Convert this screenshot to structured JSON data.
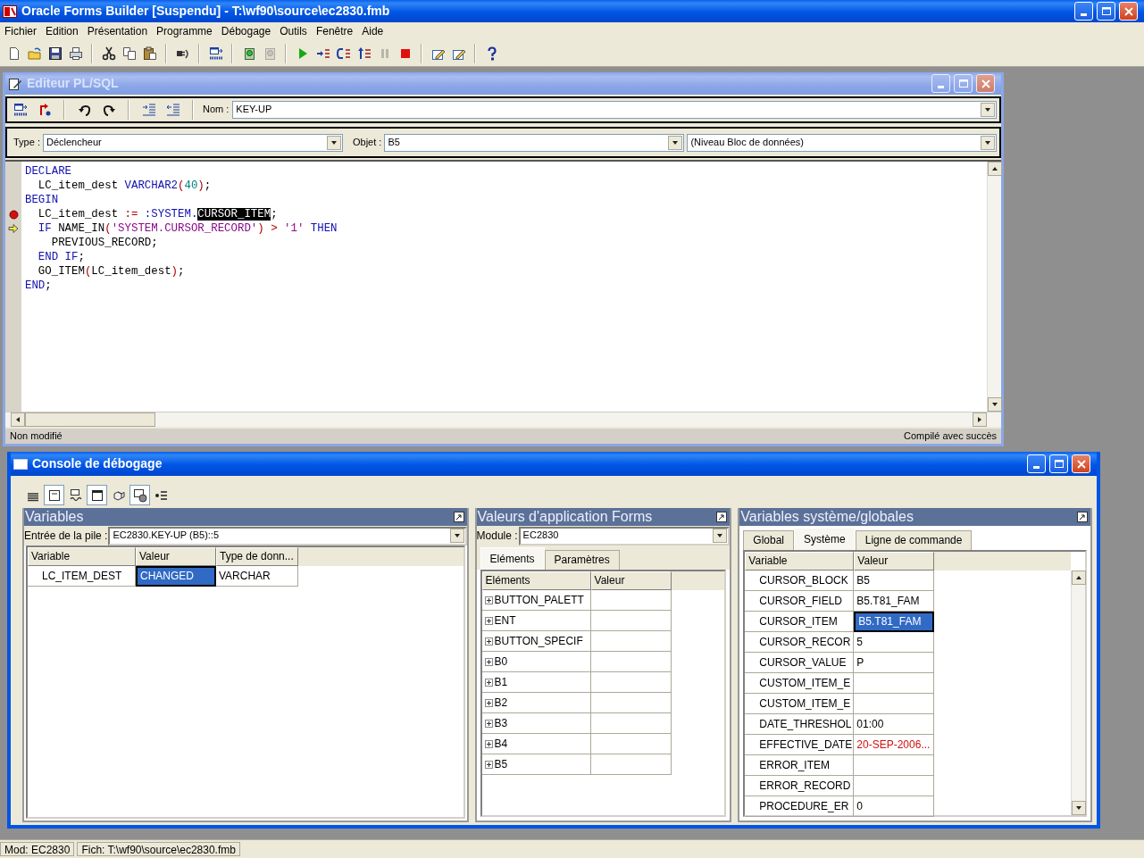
{
  "window": {
    "title": "Oracle Forms Builder [Suspendu] - T:\\wf90\\source\\ec2830.fmb"
  },
  "menu": [
    "Fichier",
    "Edition",
    "Présentation",
    "Programme",
    "Débogage",
    "Outils",
    "Fenêtre",
    "Aide"
  ],
  "toolbar": [
    {
      "kind": "new",
      "disabled": false
    },
    {
      "kind": "open",
      "disabled": false
    },
    {
      "kind": "save",
      "disabled": false
    },
    {
      "kind": "print",
      "disabled": false
    },
    {
      "kind": "sep"
    },
    {
      "kind": "cut",
      "disabled": false
    },
    {
      "kind": "copy",
      "disabled": false
    },
    {
      "kind": "paste",
      "disabled": false
    },
    {
      "kind": "sep"
    },
    {
      "kind": "connect",
      "disabled": false
    },
    {
      "kind": "sep"
    },
    {
      "kind": "compile",
      "disabled": false
    },
    {
      "kind": "sep"
    },
    {
      "kind": "run",
      "disabled": false
    },
    {
      "kind": "run",
      "disabled": true
    },
    {
      "kind": "sep"
    },
    {
      "kind": "go",
      "disabled": false
    },
    {
      "kind": "step_into",
      "disabled": false
    },
    {
      "kind": "step_over",
      "disabled": false
    },
    {
      "kind": "step_out",
      "disabled": false
    },
    {
      "kind": "pause",
      "disabled": true
    },
    {
      "kind": "stop",
      "disabled": false
    },
    {
      "kind": "sep"
    },
    {
      "kind": "edit",
      "disabled": false
    },
    {
      "kind": "edit",
      "disabled": false
    },
    {
      "kind": "sep"
    },
    {
      "kind": "help",
      "disabled": false
    }
  ],
  "editor": {
    "title": "Editeur PL/SQL",
    "name_label": "Nom :",
    "name": "KEY-UP",
    "type_label": "Type :",
    "type": "Déclencheur",
    "object_label": "Objet :",
    "object": "B5",
    "level": "(Niveau Bloc de données)",
    "lines": [
      {
        "breakpoint": false,
        "current": false,
        "tokens": [
          {
            "kind": "keyword",
            "text": "DECLARE"
          }
        ]
      },
      {
        "breakpoint": false,
        "current": false,
        "tokens": [
          {
            "kind": "plain",
            "text": "  LC_item_dest "
          },
          {
            "kind": "keyword",
            "text": "VARCHAR2"
          },
          {
            "kind": "operator",
            "text": "("
          },
          {
            "kind": "number",
            "text": "40"
          },
          {
            "kind": "operator",
            "text": ")"
          },
          {
            "kind": "plain",
            "text": ";"
          }
        ]
      },
      {
        "breakpoint": false,
        "current": false,
        "tokens": [
          {
            "kind": "keyword",
            "text": "BEGIN"
          }
        ]
      },
      {
        "breakpoint": true,
        "current": false,
        "tokens": [
          {
            "kind": "plain",
            "text": "  LC_item_dest "
          },
          {
            "kind": "operator",
            "text": ":="
          },
          {
            "kind": "keyword",
            "text": " :SYSTEM."
          },
          {
            "kind": "selection",
            "text": "CURSOR_ITEM"
          },
          {
            "kind": "plain",
            "text": ";"
          }
        ]
      },
      {
        "breakpoint": false,
        "current": true,
        "tokens": [
          {
            "kind": "keyword",
            "text": "  IF"
          },
          {
            "kind": "plain",
            "text": " NAME_IN"
          },
          {
            "kind": "operator",
            "text": "("
          },
          {
            "kind": "string",
            "text": "'SYSTEM.CURSOR_RECORD'"
          },
          {
            "kind": "operator",
            "text": ") > "
          },
          {
            "kind": "string",
            "text": "'1'"
          },
          {
            "kind": "keyword",
            "text": " THEN"
          }
        ]
      },
      {
        "breakpoint": false,
        "current": false,
        "tokens": [
          {
            "kind": "plain",
            "text": "    PREVIOUS_RECORD;"
          }
        ]
      },
      {
        "breakpoint": false,
        "current": false,
        "tokens": [
          {
            "kind": "keyword",
            "text": "  END IF"
          },
          {
            "kind": "plain",
            "text": ";"
          }
        ]
      },
      {
        "breakpoint": false,
        "current": false,
        "tokens": [
          {
            "kind": "plain",
            "text": "  GO_ITEM"
          },
          {
            "kind": "operator",
            "text": "("
          },
          {
            "kind": "plain",
            "text": "LC_item_dest"
          },
          {
            "kind": "operator",
            "text": ")"
          },
          {
            "kind": "plain",
            "text": ";"
          }
        ]
      },
      {
        "breakpoint": false,
        "current": false,
        "tokens": [
          {
            "kind": "keyword",
            "text": "END"
          },
          {
            "kind": "plain",
            "text": ";"
          }
        ]
      }
    ],
    "status_left": "Non modifié",
    "status_right": "Compilé avec succès"
  },
  "console": {
    "title": "Console de débogage",
    "toolbar": [
      {
        "kind": "stack",
        "selected": false
      },
      {
        "kind": "xv",
        "selected": true
      },
      {
        "kind": "vars",
        "selected": false
      },
      {
        "kind": "window",
        "selected": true
      },
      {
        "kind": "cubes",
        "selected": false
      },
      {
        "kind": "globe",
        "selected": true
      },
      {
        "kind": "list",
        "selected": false
      }
    ],
    "variables": {
      "title": "Variables",
      "stack_label": "Entrée de la pile :",
      "stack": "EC2830.KEY-UP (B5)::5",
      "columns": [
        "Variable",
        "Valeur",
        "Type de donn..."
      ],
      "rows": [
        {
          "variable": "LC_ITEM_DEST",
          "value": "CHANGED",
          "type": "VARCHAR",
          "selected": true
        }
      ]
    },
    "forms": {
      "title": "Valeurs d'application Forms",
      "module_label": "Module :",
      "module": "EC2830",
      "tabs": [
        {
          "label": "Eléments",
          "selected": true
        },
        {
          "label": "Paramètres",
          "selected": false
        }
      ],
      "columns": [
        "Eléments",
        "Valeur"
      ],
      "rows": [
        {
          "name": "BUTTON_PALETT",
          "expanded": false
        },
        {
          "name": "ENT",
          "expanded": false
        },
        {
          "name": "BUTTON_SPECIF",
          "expanded": false
        },
        {
          "name": "B0",
          "expanded": false
        },
        {
          "name": "B1",
          "expanded": false
        },
        {
          "name": "B2",
          "expanded": false
        },
        {
          "name": "B3",
          "expanded": false
        },
        {
          "name": "B4",
          "expanded": false
        },
        {
          "name": "B5",
          "expanded": false
        }
      ]
    },
    "system": {
      "title": "Variables système/globales",
      "tabs": [
        {
          "label": "Global",
          "selected": false
        },
        {
          "label": "Système",
          "selected": true
        },
        {
          "label": "Ligne de commande",
          "selected": false
        }
      ],
      "columns": [
        "Variable",
        "Valeur"
      ],
      "rows": [
        {
          "variable": "CURSOR_BLOCK",
          "value": "B5",
          "selected": false,
          "changed": false
        },
        {
          "variable": "CURSOR_FIELD",
          "value": "B5.T81_FAM",
          "selected": false,
          "changed": false
        },
        {
          "variable": "CURSOR_ITEM",
          "value": "B5.T81_FAM",
          "selected": true,
          "changed": false
        },
        {
          "variable": "CURSOR_RECOR",
          "value": "5",
          "selected": false,
          "changed": false
        },
        {
          "variable": "CURSOR_VALUE",
          "value": "P",
          "selected": false,
          "changed": false
        },
        {
          "variable": "CUSTOM_ITEM_E",
          "selected": false
        },
        {
          "variable": "CUSTOM_ITEM_E",
          "selected": false
        },
        {
          "variable": "DATE_THRESHOL",
          "value": "01:00",
          "selected": false,
          "changed": false
        },
        {
          "variable": "EFFECTIVE_DATE",
          "value": "20-SEP-2006...",
          "selected": false,
          "changed": true
        },
        {
          "variable": "ERROR_ITEM",
          "selected": false
        },
        {
          "variable": "ERROR_RECORD",
          "selected": false
        },
        {
          "variable": "PROCEDURE_ER",
          "value": "0",
          "selected": false,
          "changed": false
        }
      ]
    }
  },
  "status_bar": [
    "Mod: EC2830",
    "Fich: T:\\wf90\\source\\ec2830.fmb"
  ]
}
